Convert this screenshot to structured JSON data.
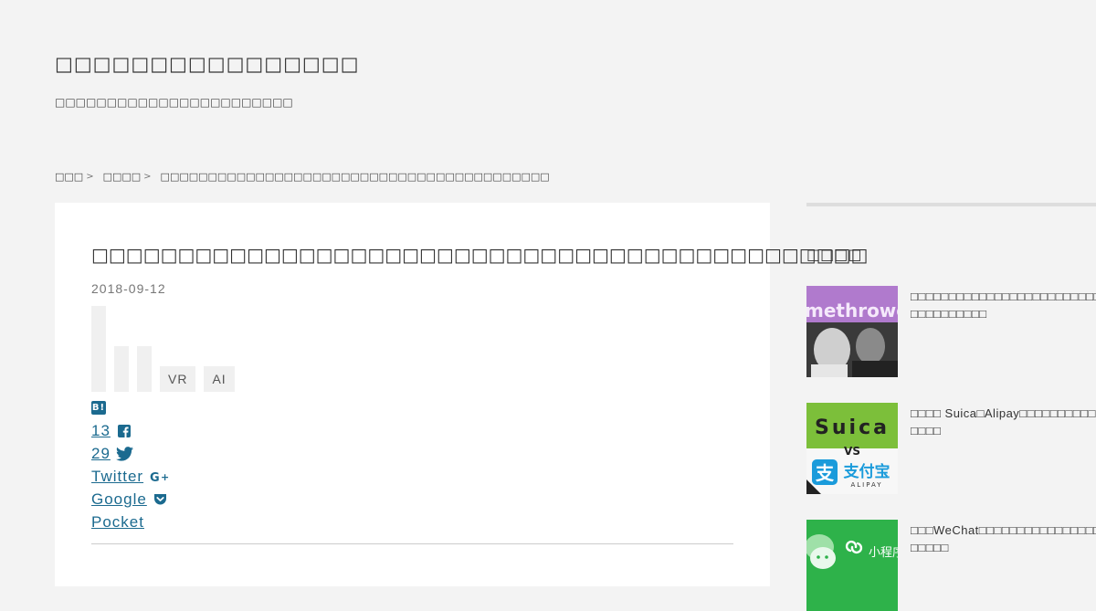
{
  "header": {
    "site_title": "□□□□□□□□□□□□□□□□",
    "site_description": "□□□□□□□□□□□□□□□□□□□□□□□"
  },
  "breadcrumb": {
    "items": [
      "□□□",
      "□□□□",
      "□□□□□□□□□□□□□□□□□□□□□□□□□□□□□□□□□□□□□□□□□"
    ]
  },
  "article": {
    "title": "□□□□□□□□□□□□□□□□□□□□□□□□□□□□□□□□□□□□□□□□□□□□□",
    "date": "2018-09-12",
    "tags": [
      "VR",
      "AI"
    ]
  },
  "share": {
    "hatena_icon": "B!",
    "facebook_count": "13",
    "twitter_count": "29",
    "twitter_label": "Twitter",
    "google_label": "Google",
    "pocket_label": "Pocket",
    "icons": [
      "hatena-icon",
      "facebook-icon",
      "twitter-icon",
      "google-plus-icon",
      "pocket-icon"
    ],
    "link_color": "#1b6a8f"
  },
  "sidebar": {
    "heading": "□□□□",
    "items": [
      {
        "text": "□□□□□□□□□□□□□□□□□□□□□□□□□□□□□□□□□□□",
        "thumb_text": "methrowe"
      },
      {
        "text": "□□□□ Suica□Alipay□□□□□□□□□□□□□□",
        "thumb_text": "Suica",
        "thumb_sub": "VS",
        "thumb_brand": "支付宝",
        "thumb_brand_latin": "ALIPAY"
      },
      {
        "text": "□□□WeChat□□□□□□□□□□□□□□□□□□□□□",
        "thumb_text": "小程序"
      }
    ]
  }
}
